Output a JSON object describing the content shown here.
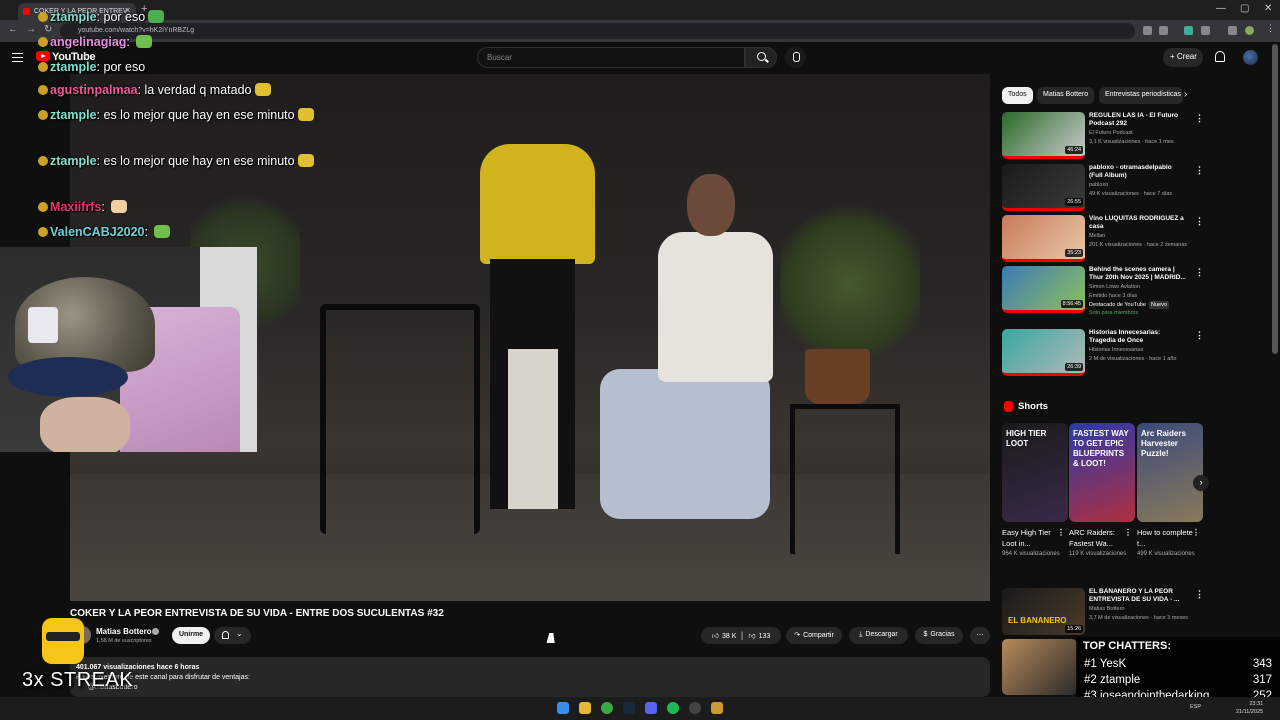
{
  "browser": {
    "tab_title": "COKER Y LA PEOR ENTREV",
    "url": "youtube.com/watch?v=hK2iYnRBZLg"
  },
  "header": {
    "wordmark": "YouTube",
    "search_placeholder": "Buscar",
    "create_label": "Crear"
  },
  "chat": {
    "messages": [
      {
        "user": "ztample",
        "text": "por eso",
        "color": "#7ee0d0"
      },
      {
        "user": "angelinagiag",
        "text": "",
        "color": "#e58de0"
      },
      {
        "user": "ztample",
        "text": "por eso",
        "color": "#7ee0d0"
      },
      {
        "user": "agustinpalmaa",
        "text": "la verdad q matado",
        "color": "#ef5a9b"
      },
      {
        "user": "ztample",
        "text": "es lo mejor que hay en ese minuto",
        "color": "#7ee0d0"
      },
      {
        "user": "ztample",
        "text": "es lo mejor que hay en ese minuto",
        "color": "#7ee0d0"
      },
      {
        "user": "Maxiifrfs",
        "text": "",
        "color": "#e6326e"
      },
      {
        "user": "ValenCABJ2020",
        "text": "",
        "color": "#6fd3d8"
      }
    ]
  },
  "video": {
    "title": "COKER Y LA PEOR ENTREVISTA DE SU VIDA - ENTRE DOS SUCULENTAS #32",
    "channel": "Matias Bottero",
    "subscribers": "1,58 M de suscriptores",
    "join_label": "Unirme",
    "likes": "38 K",
    "dislikes": "133",
    "share_label": "Compartir",
    "download_label": "Descargar",
    "thanks_label": "Gracias",
    "views_date": "401.067 visualizaciones  hace 6 horas",
    "desc_line1": "Hazte miembro de este canal para disfrutar de ventajas:",
    "desc_line2": "@matiasbottero"
  },
  "overlay": {
    "streak": "3x STREAK"
  },
  "sidebar": {
    "chips": [
      "Todos",
      "Matias Bottero",
      "Entrevistas periodísticas"
    ],
    "recommendations": [
      {
        "title": "REGULEN LAS IA  - El Futuro Podcast 292",
        "channel": "El Futuro Podcast",
        "meta": "3,1 K visualizaciones · hace 1 mes",
        "duration": "46:24",
        "badge": "",
        "c1": "#2a6b2a",
        "c2": "#c9c9c9"
      },
      {
        "title": "pabloxo - otramasdelpablo (Full Album)",
        "channel": "pabloxo",
        "meta": "49 K visualizaciones · hace 7 días",
        "duration": "26:55",
        "badge": "",
        "c1": "#1a1a1a",
        "c2": "#3a3a3a"
      },
      {
        "title": "Vino LUQUITAS RODRIGUEZ a casa",
        "channel": "Mellan",
        "meta": "201 K visualizaciones · hace 2 semanas",
        "duration": "35:23",
        "badge": "",
        "c1": "#c87a5a",
        "c2": "#e8c9a8"
      },
      {
        "title": "Behind the scenes camera | Thur 20th Nov 2025 | MADRID...",
        "channel": "Simon Lowe Aviation",
        "meta": "Emitido hace 3 días",
        "duration": "8:56:45",
        "badge": "Destacado de YouTube",
        "badge2": "Nuevo",
        "badge3": "Solo para miembros",
        "c1": "#3a7ab8",
        "c2": "#8fbf5a"
      },
      {
        "title": "Historias Innecesarias: Tragedia de Once",
        "channel": "Historias Innecesarias",
        "meta": "2 M de visualizaciones · hace 1 año",
        "duration": "26:39",
        "badge": "",
        "c1": "#3aa7a0",
        "c2": "#b0b8b8"
      }
    ],
    "shorts_title": "Shorts",
    "shorts": [
      {
        "title": "Easy High Tier Loot in...",
        "views": "964 K visualizaciones",
        "thumb_text": "HIGH TIER LOOT",
        "c1": "#1a1a1a",
        "c2": "#3a2a4a"
      },
      {
        "title": "ARC Raiders: Fastest Wa...",
        "views": "119 K visualizaciones",
        "thumb_text": "FASTEST WAY TO GET EPIC BLUEPRINTS & LOOT!",
        "c1": "#2b3aa8",
        "c2": "#b03040"
      },
      {
        "title": "How to complete t...",
        "views": "499 K visualizaciones",
        "thumb_text": "Arc Raiders Harvester Puzzle!",
        "c1": "#3a4a7a",
        "c2": "#8a7a5a"
      }
    ],
    "next_rec": {
      "title": "EL BANANERO Y LA PEOR ENTREVISTA DE SU VIDA - ...",
      "channel": "Matias Bottero",
      "meta": "3,7 M de visualizaciones · hace 3 meses",
      "duration": "15:26",
      "thumb_text": "EL BANANERO"
    }
  },
  "top_chatters": {
    "title": "TOP CHATTERS:",
    "rows": [
      {
        "rank": "#1",
        "name": "YesK",
        "count": "343"
      },
      {
        "rank": "#2",
        "name": "ztample",
        "count": "317"
      },
      {
        "rank": "#3",
        "name": "joseandointhedarking",
        "count": "252"
      }
    ]
  },
  "taskbar": {
    "lang": "ESP",
    "time": "23:31",
    "date": "21/11/2025"
  }
}
